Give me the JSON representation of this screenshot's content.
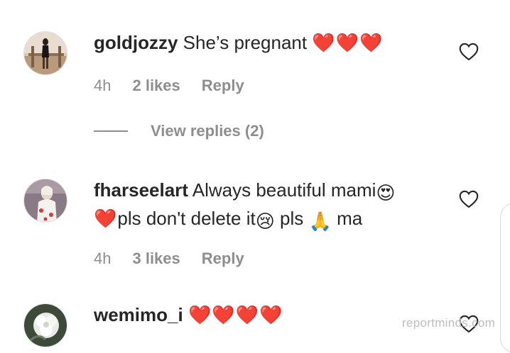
{
  "comments": [
    {
      "username": "goldjozzy",
      "text": "She’s pregnant",
      "hearts": "❤️❤️❤️",
      "time": "4h",
      "likes": "2 likes",
      "reply": "Reply",
      "avatar_icon": "profile-photo-person-standing-outdoors"
    },
    {
      "username": "fharseelart",
      "text_part1": "Always beautiful mami",
      "emoji1": "😍",
      "heart": "❤️",
      "text_part2": "pls don't delete it",
      "emoji2": "😢",
      "text_part3": " pls ",
      "emoji3": "🙏",
      "text_part4": " ma",
      "time": "4h",
      "likes": "3 likes",
      "reply": "Reply",
      "avatar_icon": "profile-photo-person-in-white"
    },
    {
      "username": "wemimo_i",
      "hearts": "❤️❤️❤️❤️",
      "avatar_icon": "profile-photo-white-flower"
    }
  ],
  "view_replies": "View replies (2)",
  "watermark": "reportminds.com",
  "colors": {
    "text": "#262626",
    "secondary": "#8e8e8e",
    "heart": "#e0182b"
  },
  "icons": {
    "like": "heart-outline-icon"
  }
}
